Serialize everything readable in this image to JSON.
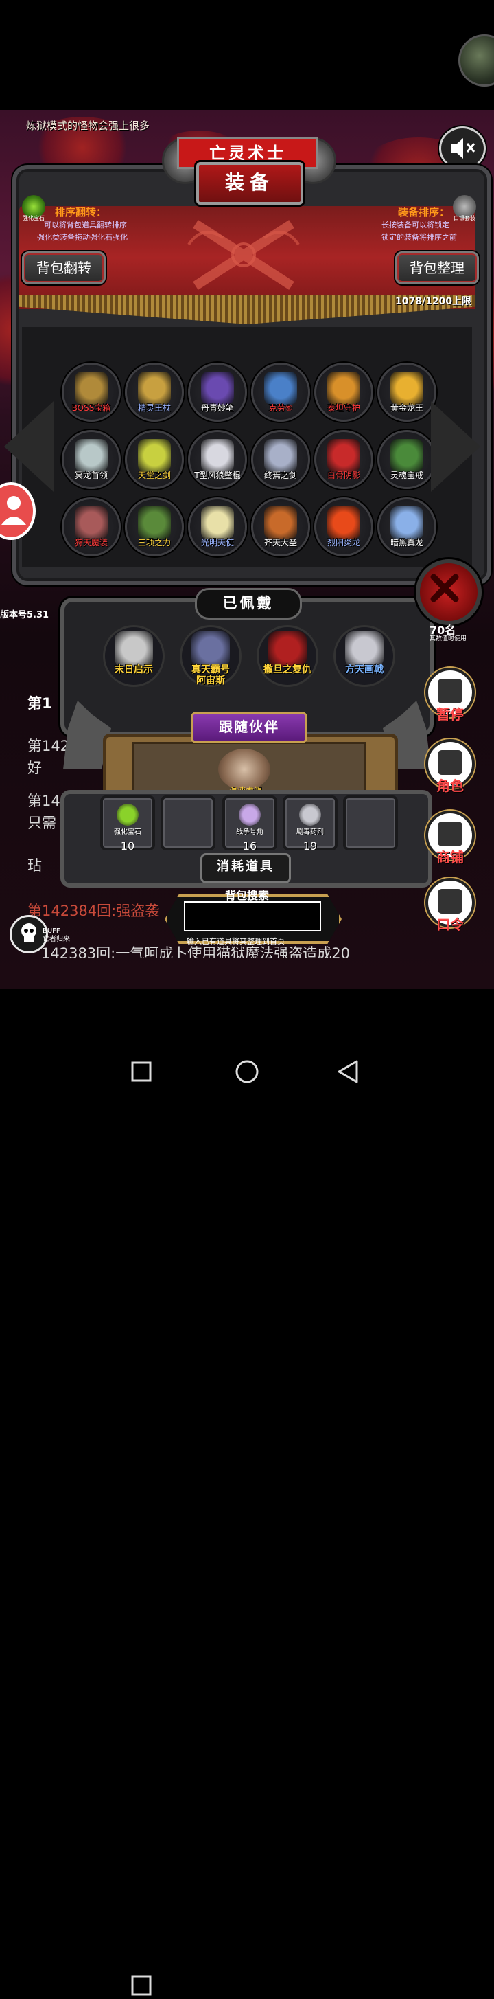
{
  "hint": "炼狱模式的怪物会强上很多",
  "top_plate": "亡灵术士",
  "title": "装备",
  "sort_flip": {
    "title": "排序翻转：",
    "line1": "可以将背包道具翻转排序",
    "line2": "强化类装备拖动强化石强化",
    "icon_label": "强化宝石"
  },
  "sort_equip": {
    "title": "装备排序：",
    "line1": "长按装备可以将锁定",
    "line2": "锁定的装备将排序之前",
    "icon_label": "白银套装"
  },
  "btn_flip": "背包翻转",
  "btn_organize": "背包整理",
  "bag_count": "1078/1200上限",
  "items": [
    {
      "label": "BOSS宝箱",
      "color": "#ff3a3a",
      "icon": "chest-icon",
      "tint": "#b08a3a"
    },
    {
      "label": "精灵王杖",
      "color": "#9ab4ff",
      "icon": "staff-icon",
      "tint": "#c8a040"
    },
    {
      "label": "丹青妙笔",
      "color": "#ffffff",
      "icon": "brush-icon",
      "tint": "#6a4ab0"
    },
    {
      "label": "克劳⑨",
      "color": "#ff3a3a",
      "icon": "character-icon",
      "tint": "#4a80c8"
    },
    {
      "label": "泰坦守护",
      "color": "#ff3a3a",
      "icon": "titan-icon",
      "tint": "#d8902a"
    },
    {
      "label": "黄金龙王",
      "color": "#ffffff",
      "icon": "gold-dragon-icon",
      "tint": "#e8b030"
    },
    {
      "label": "冥龙首领",
      "color": "#ffffff",
      "icon": "bone-dragon-icon",
      "tint": "#b8c8c8"
    },
    {
      "label": "天堂之剑",
      "color": "#ffd43a",
      "icon": "sword-icon",
      "tint": "#c8d040"
    },
    {
      "label": "T型风狼鳖棍",
      "color": "#ffffff",
      "icon": "cross-staff-icon",
      "tint": "#d8d8e0"
    },
    {
      "label": "终焉之剑",
      "color": "#ffffff",
      "icon": "blade-icon",
      "tint": "#a8b0c8"
    },
    {
      "label": "白骨阴影",
      "color": "#ff3a3a",
      "icon": "skull-plant-icon",
      "tint": "#c82a2a"
    },
    {
      "label": "灵魂宝戒",
      "color": "#ffffff",
      "icon": "ring-icon",
      "tint": "#4a8a3a"
    },
    {
      "label": "狩天魔装",
      "color": "#ff3a3a",
      "icon": "armor-icon",
      "tint": "#a85a5a"
    },
    {
      "label": "三项之力",
      "color": "#ffd43a",
      "icon": "triforce-icon",
      "tint": "#5a8a3a"
    },
    {
      "label": "光明天使",
      "color": "#9ab4ff",
      "icon": "angel-icon",
      "tint": "#e8e0a8"
    },
    {
      "label": "齐天大圣",
      "color": "#ffffff",
      "icon": "monkey-king-icon",
      "tint": "#c86a2a"
    },
    {
      "label": "烈阳炎龙",
      "color": "#9ab4ff",
      "icon": "fire-dragon-icon",
      "tint": "#e84a1a"
    },
    {
      "label": "暗黑真龙",
      "color": "#ffffff",
      "icon": "ice-dragon-icon",
      "tint": "#8ab0e8"
    }
  ],
  "version": "版本号5.31",
  "equipped_title": "已佩戴",
  "equipped": [
    {
      "label": "末日启示",
      "color": "yellow",
      "icon": "axe-icon",
      "tint": "#c8c8c8"
    },
    {
      "label": "真天霸号\n阿宙斯",
      "color": "yellow",
      "icon": "zeus-icon",
      "tint": "#6a70a0"
    },
    {
      "label": "撒旦之复仇",
      "color": "yellow",
      "icon": "demon-icon",
      "tint": "#b02020"
    },
    {
      "label": "方天画戟",
      "color": "blue",
      "icon": "halberd-icon",
      "tint": "#c8c8d0"
    }
  ],
  "companion_title": "跟随伙伴",
  "companion_label": "混沌虚鲲",
  "consumables": [
    {
      "label": "强化宝石",
      "count": "10",
      "icon": "gem-icon",
      "tint": "#8ad22a"
    },
    {
      "label": "",
      "count": "",
      "icon": "",
      "tint": ""
    },
    {
      "label": "战争号角",
      "count": "16",
      "icon": "horn-icon",
      "tint": "#c8a8e8"
    },
    {
      "label": "剧毒药剂",
      "count": "19",
      "icon": "potion-icon",
      "tint": "#c8c8d0"
    },
    {
      "label": "",
      "count": "",
      "icon": "",
      "tint": ""
    }
  ],
  "consumables_title": "消耗道具",
  "search_title": "背包搜索",
  "search_value": "",
  "search_hint": "输入已有道具将其整理到首页",
  "log": {
    "l1": "第1",
    "l2a": "第142",
    "l2b": "好",
    "l3a": "第14",
    "l3b": "只需",
    "l4": "玷",
    "red": "第142384回:强盗袭",
    "bottom": "142383回:一气呵成卜使用猫狱魔法强盗造成20"
  },
  "buff_title": "BUFF",
  "buff_sub": "亡者归来",
  "right_partial_count": "70名",
  "right_partial_sub": "其数值时使用",
  "right_menu": [
    {
      "label": "暂停",
      "icon": "dice-icon"
    },
    {
      "label": "角色",
      "icon": "hooded-character-icon"
    },
    {
      "label": "商铺",
      "icon": "shop-icon"
    },
    {
      "label": "口令",
      "icon": "scroll-icon"
    }
  ]
}
